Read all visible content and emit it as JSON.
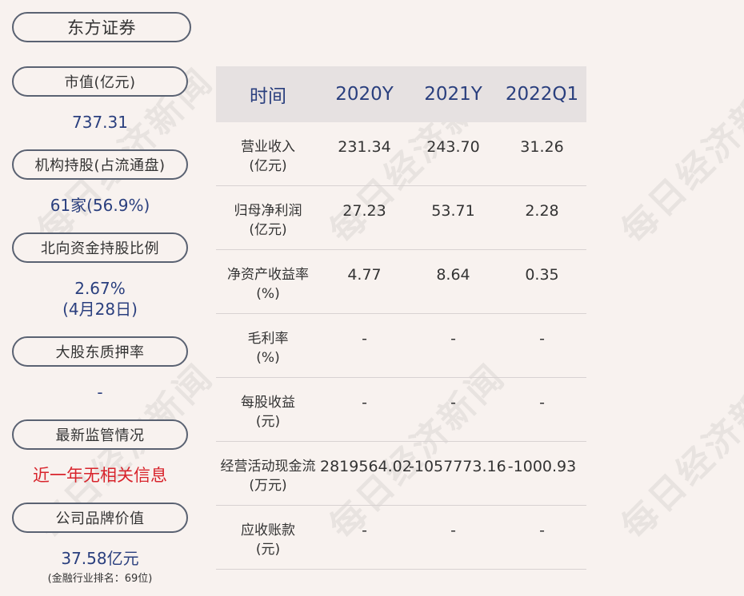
{
  "company": "东方证券",
  "sidebar": [
    {
      "label": "市值(亿元)",
      "value": "737.31"
    },
    {
      "label": "机构持股(占流通盘)",
      "value": "61家(56.9%)"
    },
    {
      "label": "北向资金持股比例",
      "value": "2.67%",
      "value2": "(4月28日)"
    },
    {
      "label": "大股东质押率",
      "value": "-"
    },
    {
      "label": "最新监管情况",
      "value": "近一年无相关信息"
    },
    {
      "label": "公司品牌价值",
      "value": "37.58亿元",
      "sub": "(金融行业排名：69位)"
    }
  ],
  "table": {
    "headers": [
      "时间",
      "2020Y",
      "2021Y",
      "2022Q1"
    ],
    "rows": [
      {
        "name": "营业收入",
        "unit": "(亿元)",
        "values": [
          "231.34",
          "243.70",
          "31.26"
        ]
      },
      {
        "name": "归母净利润",
        "unit": "(亿元)",
        "values": [
          "27.23",
          "53.71",
          "2.28"
        ]
      },
      {
        "name": "净资产收益率",
        "unit": "(%)",
        "values": [
          "4.77",
          "8.64",
          "0.35"
        ]
      },
      {
        "name": "毛利率",
        "unit": "(%)",
        "values": [
          "-",
          "-",
          "-"
        ]
      },
      {
        "name": "每股收益",
        "unit": "(元)",
        "values": [
          "-",
          "-",
          "-"
        ]
      },
      {
        "name": "经营活动现金流",
        "unit": "(万元)",
        "values": [
          "2819564.02",
          "-1057773.16",
          "-1000.93"
        ]
      },
      {
        "name": "应收账款",
        "unit": "(元)",
        "values": [
          "-",
          "-",
          "-"
        ]
      }
    ]
  },
  "watermark": "每日经济新闻",
  "colors": {
    "background": "#f8f2ef",
    "value_blue": "#2a3f7e",
    "alert_red": "#d8242c",
    "header_bg": "#e6e1e1"
  }
}
